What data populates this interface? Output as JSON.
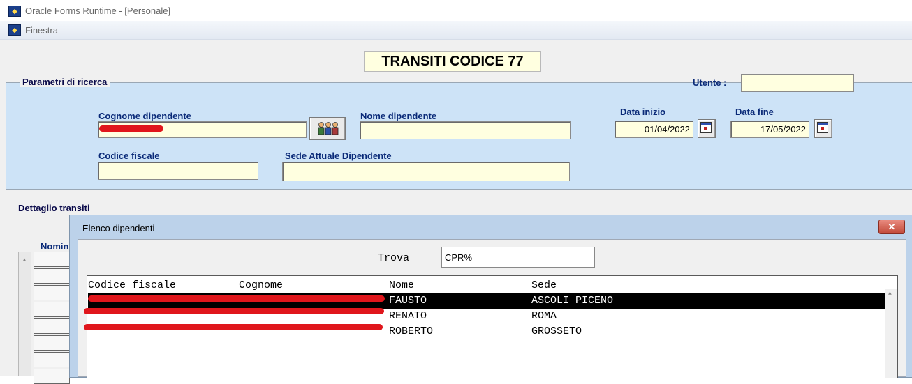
{
  "window": {
    "title": "Oracle Forms Runtime - [Personale]",
    "icon": "oracle-forms-icon",
    "menu_label": "Finestra"
  },
  "form": {
    "title": "TRANSITI CODICE 77",
    "search_frame_title": "Parametri di ricerca",
    "detail_frame_title": "Dettaglio transiti",
    "nominativo_label": "Nomin"
  },
  "fields": {
    "utente_label": "Utente :",
    "utente_value": "",
    "cognome_label": "Cognome dipendente",
    "cognome_value": "",
    "nome_label": "Nome dipendente",
    "nome_value": "",
    "codice_fiscale_label": "Codice fiscale",
    "codice_fiscale_value": "",
    "sede_label": "Sede Attuale Dipendente",
    "sede_value": "",
    "data_inizio_label": "Data inizio",
    "data_inizio_value": "01/04/2022",
    "data_fine_label": "Data fine",
    "data_fine_value": "17/05/2022"
  },
  "lov": {
    "title": "Elenco dipendenti",
    "close_icon": "close-x",
    "find_label": "Trova",
    "find_value": "CPR%",
    "columns": [
      "Codice fiscale",
      "Cognome",
      "Nome",
      "Sede"
    ],
    "rows": [
      {
        "codice_fiscale": "",
        "cognome": "",
        "nome": "FAUSTO",
        "sede": "ASCOLI PICENO",
        "selected": true
      },
      {
        "codice_fiscale": "",
        "cognome": "",
        "nome": "RENATO",
        "sede": "ROMA",
        "selected": false
      },
      {
        "codice_fiscale": "",
        "cognome": "",
        "nome": "ROBERTO",
        "sede": "GROSSETO",
        "selected": false
      }
    ]
  },
  "colors": {
    "frame_bg": "#cde3f7",
    "field_bg": "#ffffe0",
    "label_text": "#0a2a78",
    "redaction": "#e0161c",
    "selected_row_bg": "#000000"
  }
}
